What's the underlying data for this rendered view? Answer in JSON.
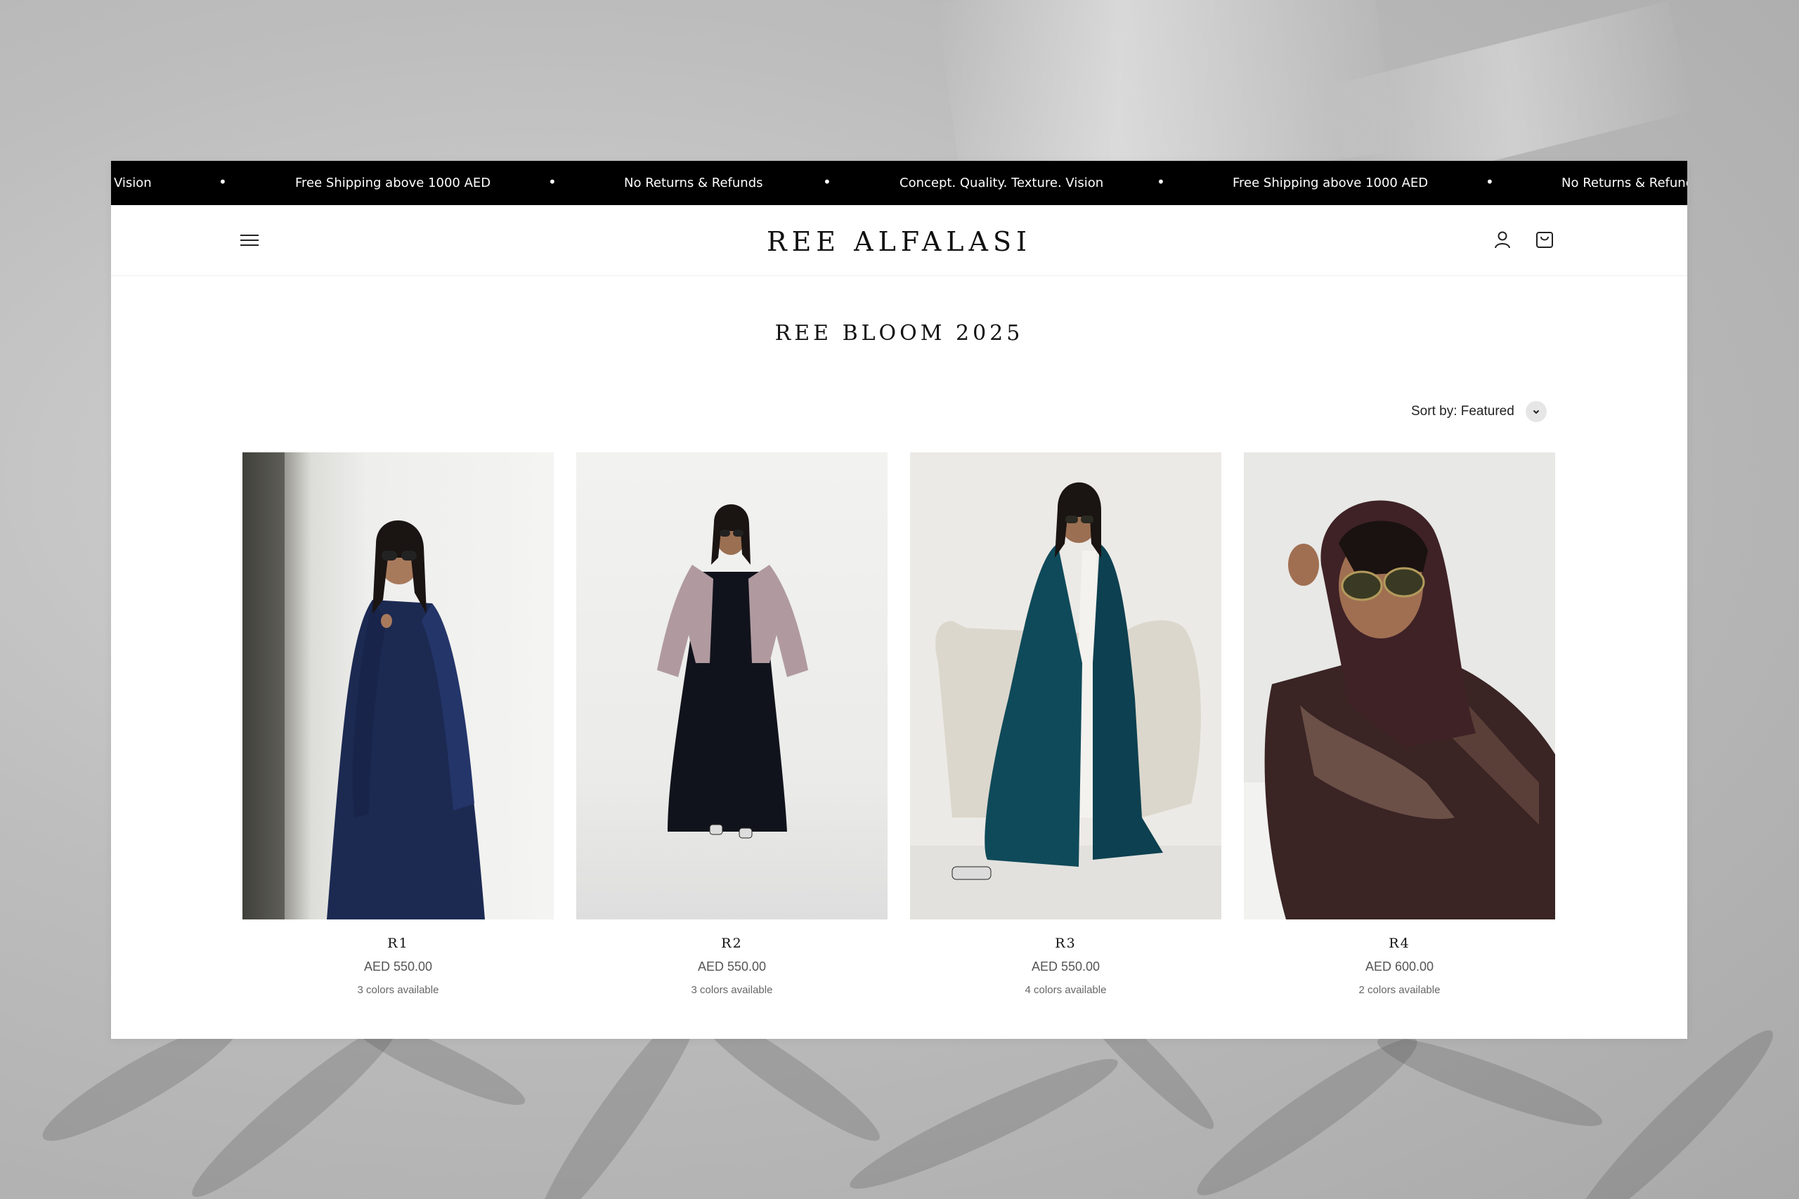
{
  "announcement": {
    "items": [
      "Vision",
      "Free Shipping above 1000 AED",
      "No Returns & Refunds",
      "Concept. Quality. Texture. Vision",
      "Free Shipping above 1000 AED",
      "No Returns & Refunds"
    ],
    "separator": "•"
  },
  "header": {
    "logo": "REE ALFALASI",
    "menu_icon": "hamburger-menu-icon",
    "account_icon": "user-icon",
    "cart_icon": "shopping-bag-icon"
  },
  "collection": {
    "title": "REE BLOOM 2025",
    "sort_label": "Sort by: Featured"
  },
  "products": [
    {
      "name": "R1",
      "price": "AED 550.00",
      "colors": "3 colors available"
    },
    {
      "name": "R2",
      "price": "AED 550.00",
      "colors": "3 colors available"
    },
    {
      "name": "R3",
      "price": "AED 550.00",
      "colors": "4 colors available"
    },
    {
      "name": "R4",
      "price": "AED 600.00",
      "colors": "2 colors available"
    }
  ],
  "colors": {
    "announcement_bg": "#000000",
    "text": "#111111",
    "garment_r1": "#1c2a52",
    "garment_r2": "#b09aa0",
    "garment_r3": "#0f4a5a",
    "garment_r4": "#3a2424"
  }
}
